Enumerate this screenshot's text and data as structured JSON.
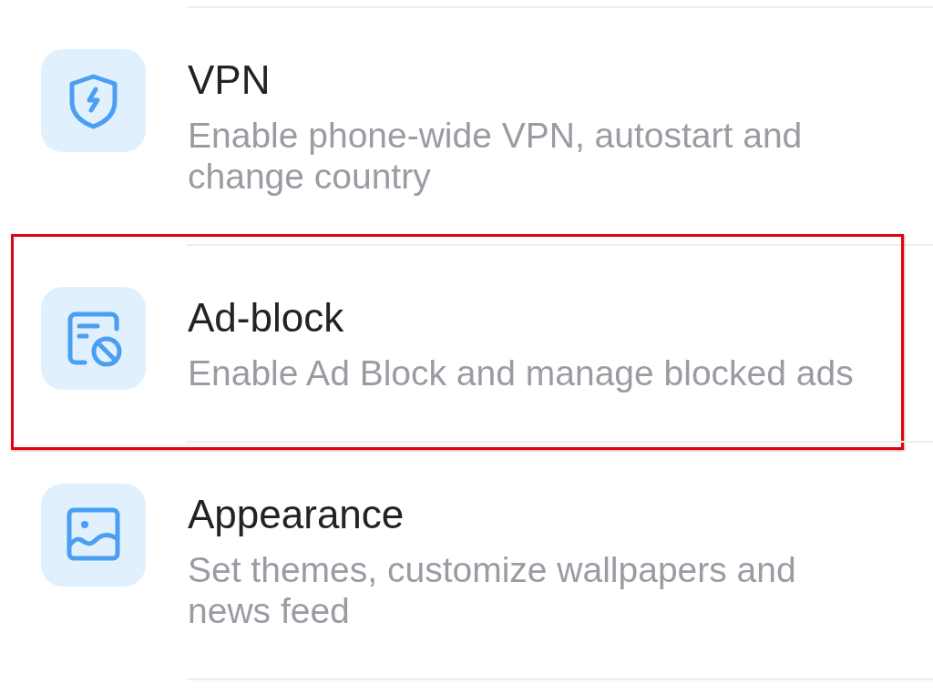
{
  "settings_items": [
    {
      "kind": "vpn",
      "title": "VPN",
      "description": "Enable phone-wide VPN, autostart and change country",
      "highlighted": false
    },
    {
      "kind": "ad_block",
      "title": "Ad-block",
      "description": "Enable Ad Block and manage blocked ads",
      "highlighted": true
    },
    {
      "kind": "appearance",
      "title": "Appearance",
      "description": "Set themes, customize wallpapers and news feed",
      "highlighted": false
    }
  ]
}
